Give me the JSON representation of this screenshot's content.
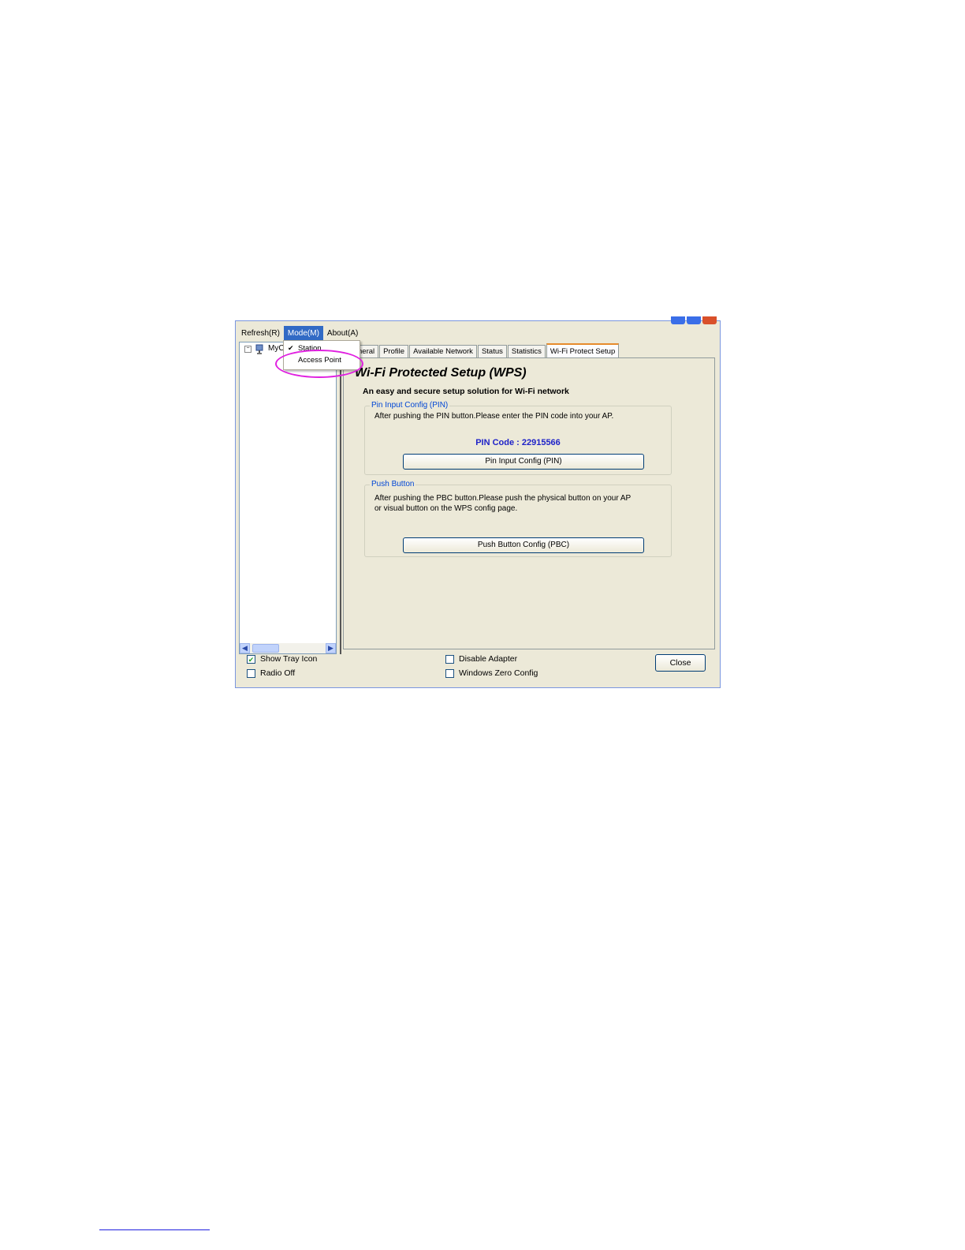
{
  "menu": {
    "items": [
      {
        "label": "Refresh(R)"
      },
      {
        "label": "Mode(M)"
      },
      {
        "label": "About(A)"
      }
    ],
    "mode_dropdown": {
      "station": "Station",
      "access_point": "Access Point"
    }
  },
  "tree": {
    "root_label": "MyC",
    "expander": "−"
  },
  "tabs": [
    {
      "label": "neral"
    },
    {
      "label": "Profile"
    },
    {
      "label": "Available Network"
    },
    {
      "label": "Status"
    },
    {
      "label": "Statistics"
    },
    {
      "label": "Wi-Fi Protect Setup"
    }
  ],
  "wps": {
    "title": "Wi-Fi Protected Setup (WPS)",
    "subtitle": "An easy and secure setup solution for Wi-Fi network",
    "pin_group": {
      "legend": "Pin Input Config (PIN)",
      "description": "After pushing the PIN button.Please enter the PIN code into your AP.",
      "pin_code_text": "PIN Code :  22915566",
      "button": "Pin Input Config (PIN)"
    },
    "pbc_group": {
      "legend": "Push Button",
      "description_line1": "After pushing the PBC button.Please push the physical button on your AP",
      "description_line2": "or visual button on the WPS config page.",
      "button": "Push Button Config (PBC)"
    }
  },
  "bottom": {
    "show_tray_icon": "Show Tray Icon",
    "radio_off": "Radio Off",
    "disable_adapter": "Disable Adapter",
    "windows_zero_config": "Windows Zero Config",
    "close": "Close"
  },
  "colors": {
    "highlight": "#e020e0",
    "menu_active": "#316ac5",
    "pin_code": "#1e22c8"
  }
}
